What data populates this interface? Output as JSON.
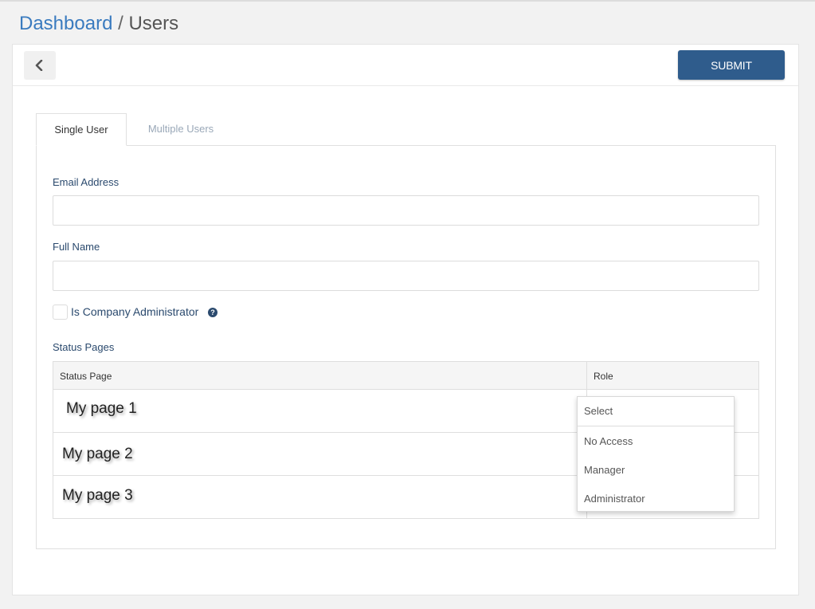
{
  "breadcrumb": {
    "root": "Dashboard",
    "separator": " / ",
    "current": "Users"
  },
  "toolbar": {
    "submit_label": "SUBMIT"
  },
  "tabs": [
    {
      "label": "Single User",
      "active": true
    },
    {
      "label": "Multiple Users",
      "active": false
    }
  ],
  "form": {
    "email_label": "Email Address",
    "email_value": "",
    "fullname_label": "Full Name",
    "fullname_value": "",
    "admin_label": "Is Company Administrator",
    "admin_checked": false,
    "status_pages_label": "Status Pages"
  },
  "table": {
    "headers": [
      "Status Page",
      "Role"
    ],
    "rows": [
      {
        "page": "My page 1"
      },
      {
        "page": "My page 2"
      },
      {
        "page": "My page 3"
      }
    ]
  },
  "role_dropdown": {
    "placeholder": "Select",
    "options": [
      "No Access",
      "Manager",
      "Administrator"
    ]
  },
  "colors": {
    "accent": "#3a7bbf",
    "submit_bg": "#2f5c8c",
    "label": "#2b4a6e"
  }
}
